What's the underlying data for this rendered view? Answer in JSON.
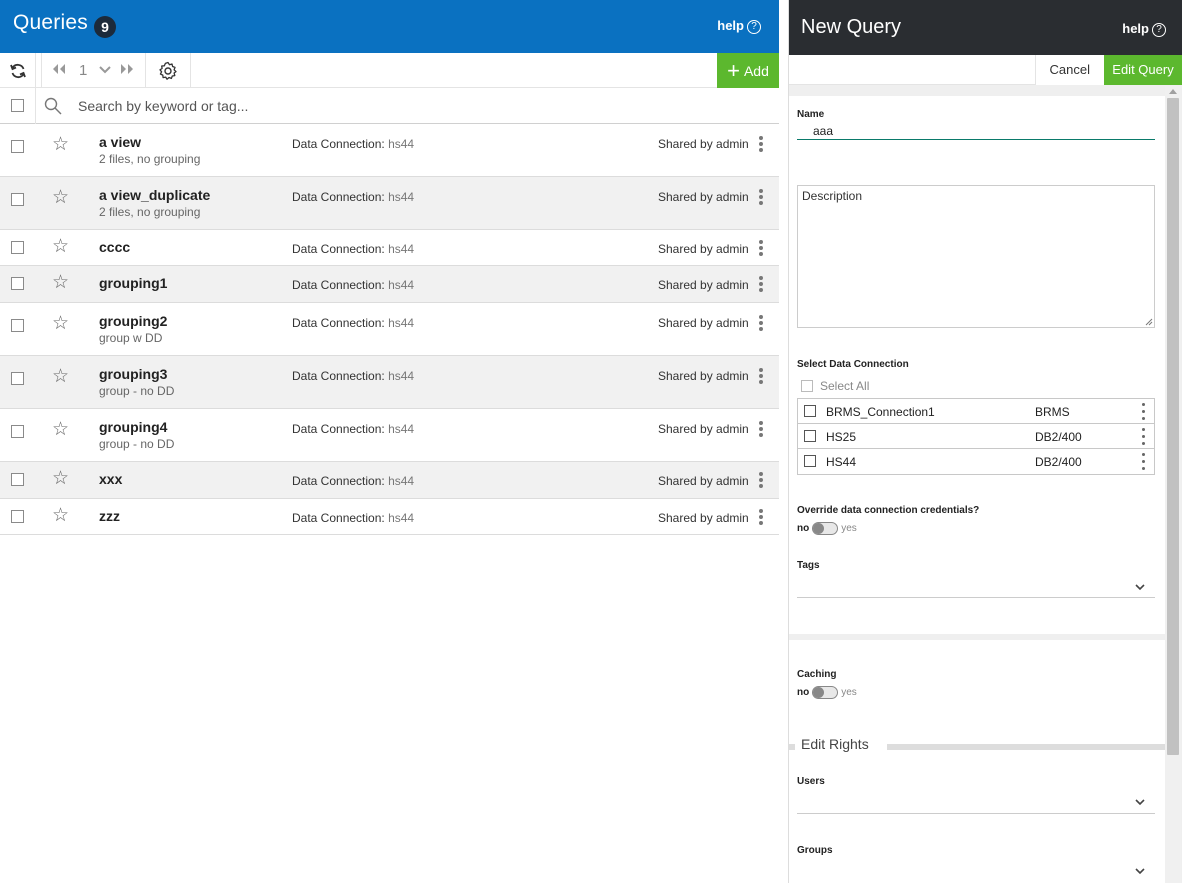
{
  "queries_panel": {
    "title": "Queries",
    "count": "9",
    "help_label": "help",
    "page_number": "1",
    "add_label": "Add",
    "search_placeholder": "Search by keyword or tag...",
    "rows": [
      {
        "name": "a view",
        "sub": "2 files, no grouping",
        "dc_label": "Data Connection:",
        "dc_value": "hs44",
        "shared": "Shared by admin"
      },
      {
        "name": "a view_duplicate",
        "sub": "2 files, no grouping",
        "dc_label": "Data Connection:",
        "dc_value": "hs44",
        "shared": "Shared by admin"
      },
      {
        "name": "cccc",
        "sub": "",
        "dc_label": "Data Connection:",
        "dc_value": "hs44",
        "shared": "Shared by admin"
      },
      {
        "name": "grouping1",
        "sub": "",
        "dc_label": "Data Connection:",
        "dc_value": "hs44",
        "shared": "Shared by admin"
      },
      {
        "name": "grouping2",
        "sub": "group w DD",
        "dc_label": "Data Connection:",
        "dc_value": "hs44",
        "shared": "Shared by admin"
      },
      {
        "name": "grouping3",
        "sub": "group - no DD",
        "dc_label": "Data Connection:",
        "dc_value": "hs44",
        "shared": "Shared by admin"
      },
      {
        "name": "grouping4",
        "sub": "group - no DD",
        "dc_label": "Data Connection:",
        "dc_value": "hs44",
        "shared": "Shared by admin"
      },
      {
        "name": "xxx",
        "sub": "",
        "dc_label": "Data Connection:",
        "dc_value": "hs44",
        "shared": "Shared by admin"
      },
      {
        "name": "zzz",
        "sub": "",
        "dc_label": "Data Connection:",
        "dc_value": "hs44",
        "shared": "Shared by admin"
      }
    ]
  },
  "new_query_panel": {
    "title": "New Query",
    "help_label": "help",
    "cancel_label": "Cancel",
    "edit_label": "Edit Query",
    "name_label": "Name",
    "name_value": "aaa",
    "description_placeholder": "Description",
    "select_dc_label": "Select Data Connection",
    "select_all_label": "Select All",
    "connections": [
      {
        "name": "BRMS_Connection1",
        "type": "BRMS"
      },
      {
        "name": "HS25",
        "type": "DB2/400"
      },
      {
        "name": "HS44",
        "type": "DB2/400"
      }
    ],
    "override_label": "Override data connection credentials?",
    "toggle_no": "no",
    "toggle_yes": "yes",
    "tags_label": "Tags",
    "caching_label": "Caching",
    "edit_rights_label": "Edit Rights",
    "users_label": "Users",
    "groups_label": "Groups"
  },
  "colors": {
    "queries_header": "#0a71c1",
    "new_query_header": "#2a2d31",
    "accent_green": "#5cb82e"
  }
}
